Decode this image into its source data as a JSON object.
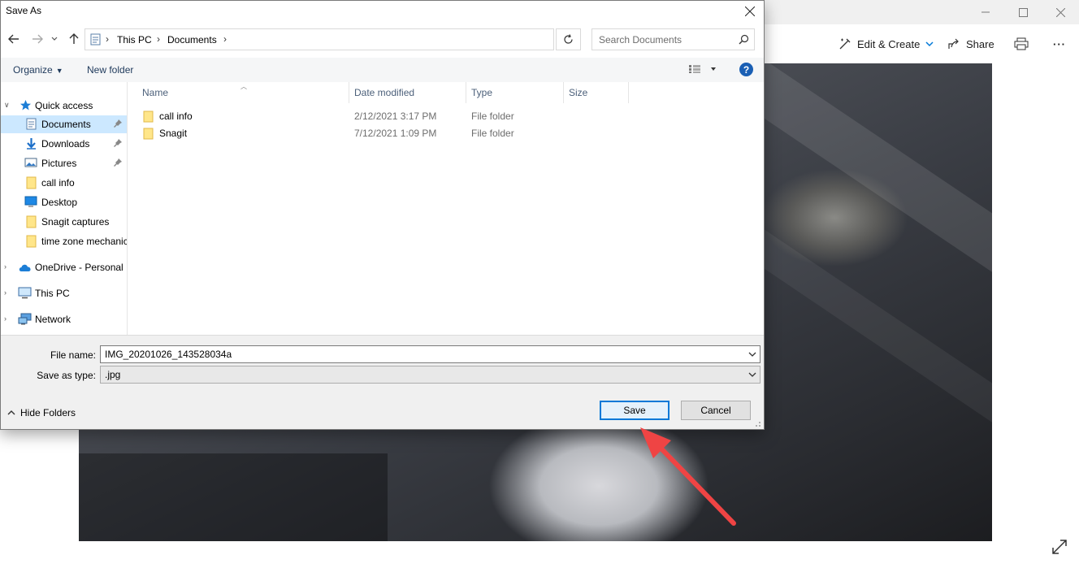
{
  "photos": {
    "edit_create_label": "Edit & Create",
    "share_label": "Share",
    "more_label": "···"
  },
  "dialog": {
    "title": "Save As",
    "breadcrumb": [
      "This PC",
      "Documents"
    ],
    "search_placeholder": "Search Documents",
    "organize_label": "Organize",
    "new_folder_label": "New folder",
    "help_label": "?",
    "nav_items": [
      {
        "label": "Quick access",
        "icon": "star-icon"
      },
      {
        "label": "Documents",
        "icon": "documents-icon",
        "pinned": true,
        "selected": true
      },
      {
        "label": "Downloads",
        "icon": "download-arrow-icon",
        "pinned": true
      },
      {
        "label": "Pictures",
        "icon": "pictures-icon",
        "pinned": true
      },
      {
        "label": "call info",
        "icon": "folder-icon"
      },
      {
        "label": "Desktop",
        "icon": "desktop-icon"
      },
      {
        "label": "Snagit captures",
        "icon": "folder-icon"
      },
      {
        "label": "time zone mechanic",
        "icon": "folder-icon"
      },
      {
        "label": "OneDrive - Personal",
        "icon": "cloud-icon"
      },
      {
        "label": "This PC",
        "icon": "computer-icon"
      },
      {
        "label": "Network",
        "icon": "network-icon"
      }
    ],
    "columns": {
      "name": "Name",
      "date_modified": "Date modified",
      "type": "Type",
      "size": "Size"
    },
    "files": [
      {
        "name": "call info",
        "date_modified": "2/12/2021 3:17 PM",
        "type": "File folder"
      },
      {
        "name": "Snagit",
        "date_modified": "7/12/2021 1:09 PM",
        "type": "File folder"
      }
    ],
    "file_name_label": "File name:",
    "file_name_value": "IMG_20201026_143528034a",
    "save_type_label": "Save as type:",
    "save_type_value": ".jpg",
    "hide_folders_label": "Hide Folders",
    "save_label": "Save",
    "cancel_label": "Cancel"
  },
  "colors": {
    "accent": "#0078d7",
    "selection": "#cce8ff",
    "annotation_arrow": "#ef4444"
  }
}
